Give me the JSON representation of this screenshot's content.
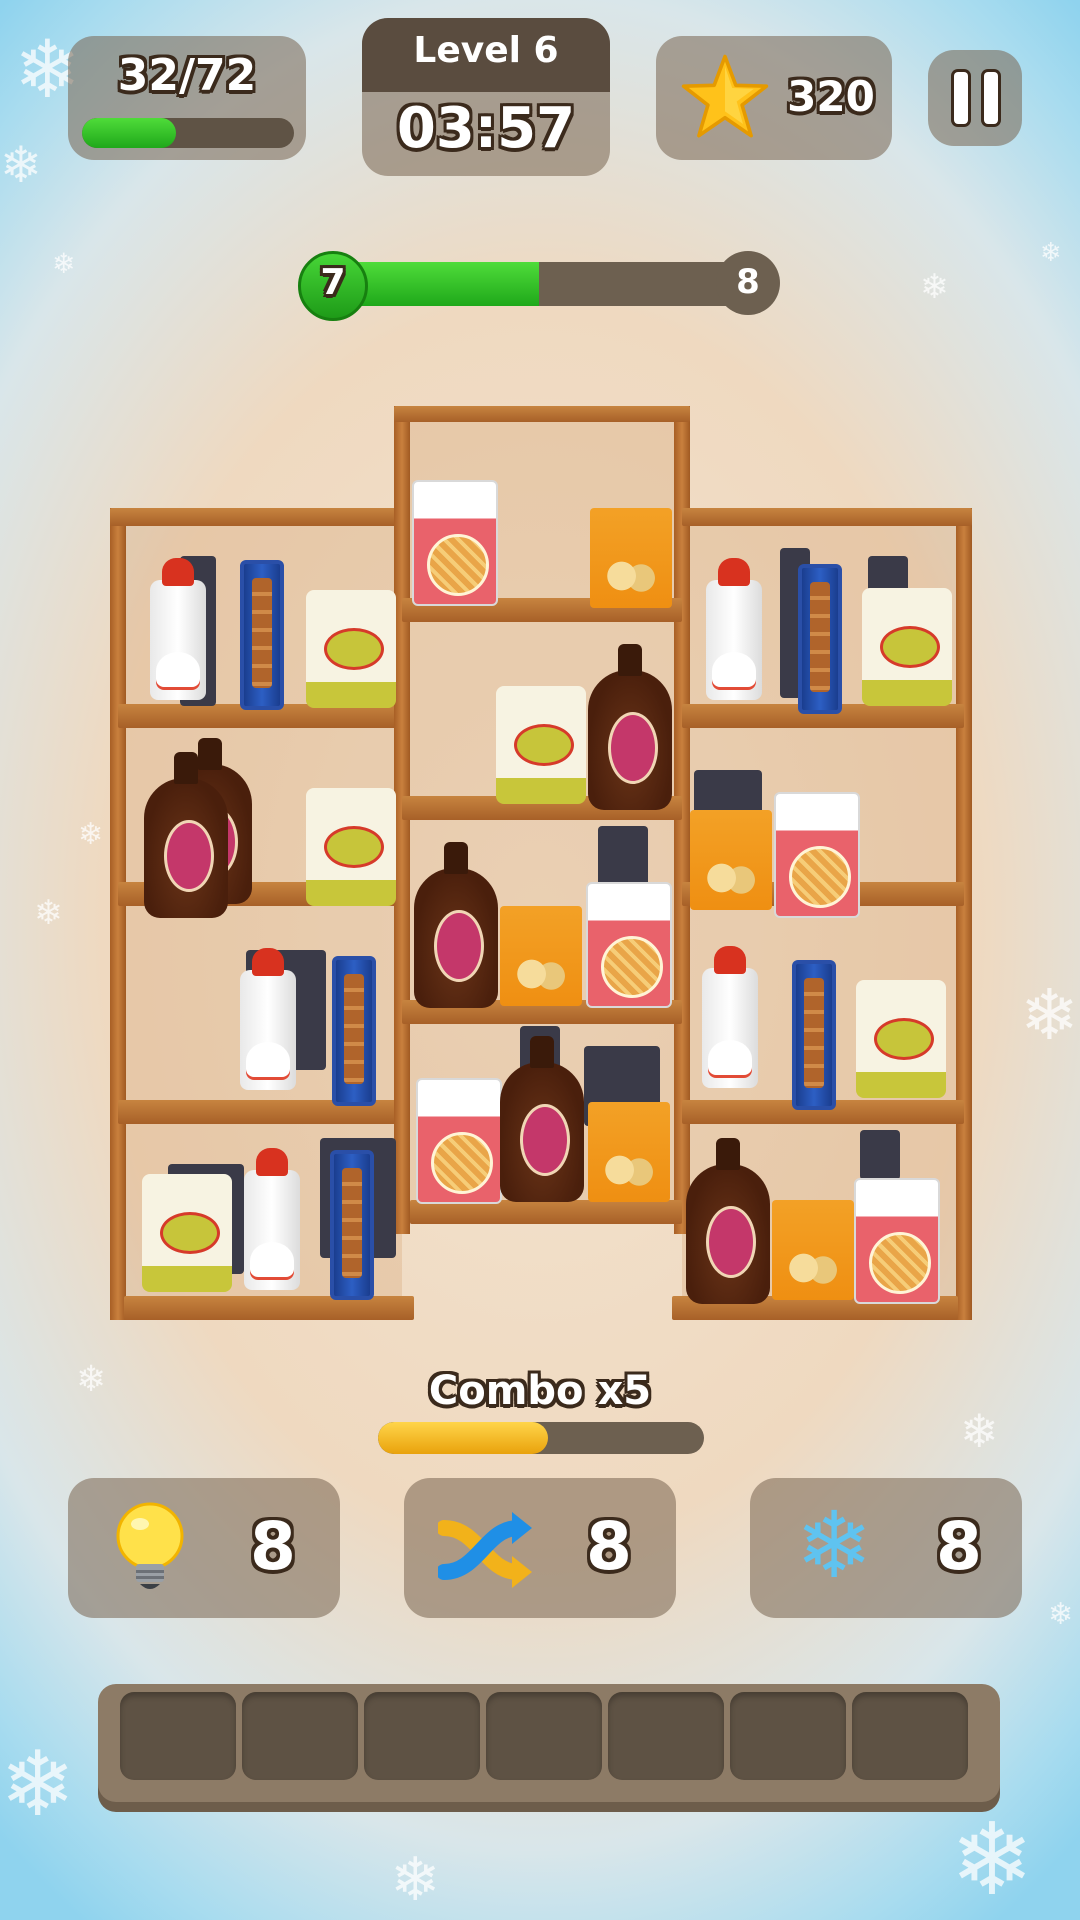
{
  "hud": {
    "items_progress_text": "32/72",
    "items_progress_fraction": 0.444,
    "level_label": "Level 6",
    "timer": "03:57",
    "stars_count": "320",
    "star_icon": "star-icon",
    "pause_icon": "pause-icon"
  },
  "level_progress": {
    "current": "7",
    "next": "8",
    "fill_fraction": 0.5
  },
  "combo": {
    "label": "Combo x5",
    "fill_fraction": 0.52
  },
  "boosters": [
    {
      "name": "hint",
      "icon": "lightbulb-icon",
      "count": "8"
    },
    {
      "name": "shuffle",
      "icon": "shuffle-icon",
      "count": "8"
    },
    {
      "name": "freeze",
      "icon": "snowflake-icon",
      "count": "8"
    }
  ],
  "tray": {
    "slot_count": 7
  },
  "shelf_products": [
    "Creamy Whip",
    "Fish Sticks",
    "Wheat Flour",
    "Dreamy Syrup",
    "French Fries",
    "Chicken Nuggets"
  ],
  "colors": {
    "green_fill": "#2fbe24",
    "combo_fill": "#f2b51c",
    "panel": "#7a6652",
    "shelf_wood": "#b86c2e"
  }
}
